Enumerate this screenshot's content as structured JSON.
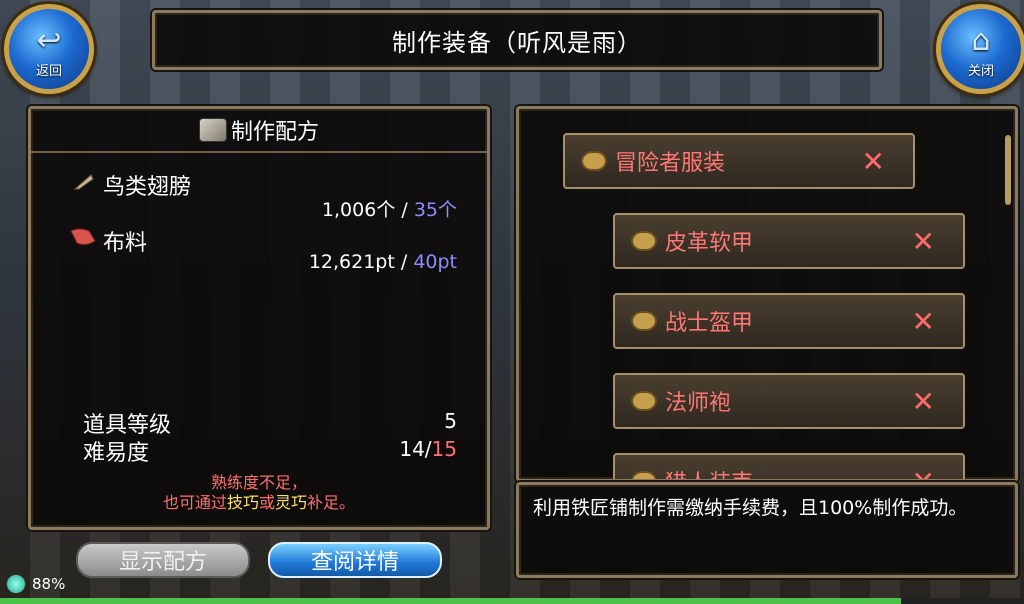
{
  "title": "制作装备（听风是雨）",
  "back_button": {
    "label": "返回",
    "icon": "back-arrow-icon"
  },
  "close_button": {
    "label": "关闭",
    "icon": "home-icon"
  },
  "recipe": {
    "header": "制作配方",
    "materials": [
      {
        "name": "鸟类翅膀",
        "have": "1,006个",
        "sep": " / ",
        "need": "35个",
        "icon": "feather-icon"
      },
      {
        "name": "布料",
        "have": "12,621pt",
        "sep": " / ",
        "need": "40pt",
        "icon": "cloth-icon"
      }
    ],
    "item_level_label": "道具等级",
    "item_level_value": "5",
    "difficulty_label": "难易度",
    "difficulty_have": "14",
    "difficulty_sep": "/",
    "difficulty_need": "15",
    "warning_line1": "熟练度不足，",
    "warning_prefix": "也可通过",
    "warning_skill1": "技巧",
    "warning_or": "或",
    "warning_skill2": "灵巧",
    "warning_suffix": "补足。"
  },
  "buttons": {
    "show_recipe": "显示配方",
    "view_details": "查阅详情"
  },
  "categories": [
    {
      "label": "冒险者服装",
      "close": "✕"
    },
    {
      "label": "皮革软甲",
      "close": "✕"
    },
    {
      "label": "战士盔甲",
      "close": "✕"
    },
    {
      "label": "法师袍",
      "close": "✕"
    },
    {
      "label": "猎人装束",
      "close": "✕"
    }
  ],
  "info_text": "利用铁匠铺制作需缴纳手续费，且100%制作成功。",
  "status": {
    "percent": "88%",
    "progress": 0.88
  },
  "colors": {
    "accent_blue": "#8c8cff",
    "warn_red": "#ff6f6f",
    "gold_frame": "#8a7a5e"
  }
}
